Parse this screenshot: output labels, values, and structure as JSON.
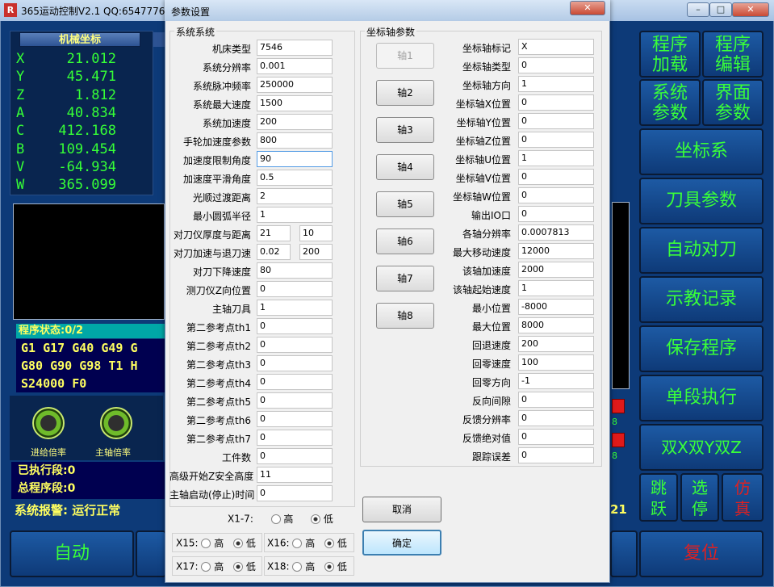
{
  "main": {
    "title": "365运动控制V2.1 QQ:6547776",
    "logo": "R",
    "coord_header": "机械坐标",
    "axes": [
      {
        "name": "X",
        "value": "21.012"
      },
      {
        "name": "Y",
        "value": "45.471"
      },
      {
        "name": "Z",
        "value": "1.812"
      },
      {
        "name": "A",
        "value": "40.834"
      },
      {
        "name": "C",
        "value": "412.168"
      },
      {
        "name": "B",
        "value": "109.454"
      },
      {
        "name": "V",
        "value": "-64.934"
      },
      {
        "name": "W",
        "value": "365.099"
      }
    ],
    "program_status": "程序状态:0/2",
    "gcode": [
      "G1 G17 G40 G49 G",
      "G80 G90 G98 T1 H",
      "S24000 F0"
    ],
    "knob_feed": "进给倍率",
    "knob_spindle": "主轴倍率",
    "executed": "已执行段:0",
    "total": "总程序段:0",
    "alarm": "系统报警: 运行正常",
    "auto_btn": "自动",
    "reset_btn": "复位",
    "right_buttons": {
      "prog_load": "程序\n加载",
      "prog_edit": "程序\n编辑",
      "sys_param": "系统\n参数",
      "ui_param": "界面\n参数",
      "coord": "坐标系",
      "tool": "刀具参数",
      "autotool": "自动对刀",
      "teach": "示教记录",
      "save": "保存程序",
      "single": "单段执行",
      "dual": "双X双Y双Z",
      "jump": "跳\n跃",
      "stop": "选\n停",
      "sim": "仿\n真"
    },
    "side_digits": {
      "a": "8",
      "b": "8",
      "c": "21"
    }
  },
  "dialog": {
    "title": "参数设置",
    "system_group": "系统系统",
    "axis_group": "坐标轴参数",
    "sys_rows": [
      {
        "label": "机床类型",
        "value": "7546"
      },
      {
        "label": "系统分辨率",
        "value": "0.001"
      },
      {
        "label": "系统脉冲频率",
        "value": "250000"
      },
      {
        "label": "系统最大速度",
        "value": "1500"
      },
      {
        "label": "系统加速度",
        "value": "200"
      },
      {
        "label": "手轮加速度参数",
        "value": "800"
      },
      {
        "label": "加速度限制角度",
        "value": "90"
      },
      {
        "label": "加速度平滑角度",
        "value": "0.5"
      },
      {
        "label": "光顺过渡距离",
        "value": "2"
      },
      {
        "label": "最小圆弧半径",
        "value": "1"
      }
    ],
    "tool_rows": [
      {
        "label": "对刀仪厚度与距离",
        "v1": "21",
        "v2": "10"
      },
      {
        "label": "对刀加速与退刀速",
        "v1": "0.02",
        "v2": "200"
      }
    ],
    "sys_rows2": [
      {
        "label": "对刀下降速度",
        "value": "80"
      },
      {
        "label": "测刀仪Z向位置",
        "value": "0"
      },
      {
        "label": "主轴刀具",
        "value": "1"
      },
      {
        "label": "第二参考点th1",
        "value": "0"
      },
      {
        "label": "第二参考点th2",
        "value": "0"
      },
      {
        "label": "第二参考点th3",
        "value": "0"
      },
      {
        "label": "第二参考点th4",
        "value": "0"
      },
      {
        "label": "第二参考点th5",
        "value": "0"
      },
      {
        "label": "第二参考点th6",
        "value": "0"
      },
      {
        "label": "第二参考点th7",
        "value": "0"
      },
      {
        "label": "工件数",
        "value": "0"
      }
    ],
    "extra_rows": [
      {
        "label": "高级开始Z安全高度",
        "value": "11"
      },
      {
        "label": "主轴启动(停止)时间",
        "value": "0"
      }
    ],
    "axis_buttons": [
      "轴1",
      "轴2",
      "轴3",
      "轴4",
      "轴5",
      "轴6",
      "轴7",
      "轴8"
    ],
    "axis_rows": [
      {
        "label": "坐标轴标记",
        "value": "X"
      },
      {
        "label": "坐标轴类型",
        "value": "0"
      },
      {
        "label": "坐标轴方向",
        "value": "1"
      },
      {
        "label": "坐标轴X位置",
        "value": "0"
      },
      {
        "label": "坐标轴Y位置",
        "value": "0"
      },
      {
        "label": "坐标轴Z位置",
        "value": "0"
      },
      {
        "label": "坐标轴U位置",
        "value": "1"
      },
      {
        "label": "坐标轴V位置",
        "value": "0"
      },
      {
        "label": "坐标轴W位置",
        "value": "0"
      },
      {
        "label": "输出IO口",
        "value": "0"
      },
      {
        "label": "各轴分辨率",
        "value": "0.0007813"
      },
      {
        "label": "最大移动速度",
        "value": "12000"
      },
      {
        "label": "该轴加速度",
        "value": "2000"
      },
      {
        "label": "该轴起始速度",
        "value": "1"
      },
      {
        "label": "最小位置",
        "value": "-8000"
      },
      {
        "label": "最大位置",
        "value": "8000"
      },
      {
        "label": "回退速度",
        "value": "200"
      },
      {
        "label": "回零速度",
        "value": "100"
      },
      {
        "label": "回零方向",
        "value": "-1"
      },
      {
        "label": "反向间隙",
        "value": "0"
      },
      {
        "label": "反馈分辨率",
        "value": "0"
      },
      {
        "label": "反馈绝对值",
        "value": "0"
      },
      {
        "label": "跟踪误差",
        "value": "0"
      }
    ],
    "radio_x17": "X1-7:",
    "radio_x15": "X15:",
    "radio_x16": "X16:",
    "radio_x17b": "X17:",
    "radio_x18": "X18:",
    "high": "高",
    "low": "低",
    "cancel": "取消",
    "ok": "确定"
  }
}
